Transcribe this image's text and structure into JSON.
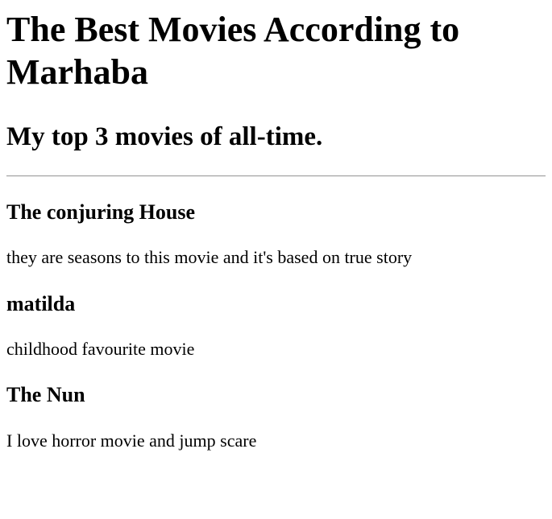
{
  "page": {
    "title": "The Best Movies According to Marhaba",
    "subtitle": "My top 3 movies of all-time."
  },
  "movies": [
    {
      "title": "The conjuring House",
      "description": "they are seasons to this movie and it's based on true story"
    },
    {
      "title": "matilda",
      "description": "childhood favourite movie"
    },
    {
      "title": "The Nun",
      "description": "I love horror movie and jump scare"
    }
  ]
}
